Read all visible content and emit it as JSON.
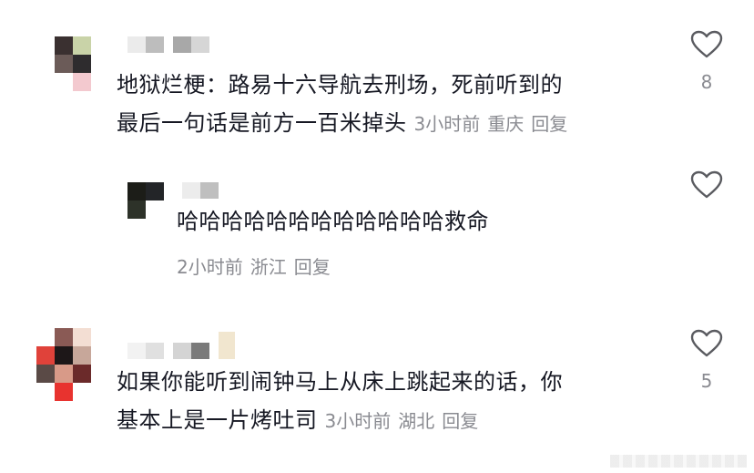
{
  "comments": [
    {
      "text_line1": "地狱烂梗：路易十六导航去刑场，死前听到的",
      "text_line2": "最后一句话是前方一百米掉头",
      "time": "3小时前",
      "location": "重庆",
      "reply_label": "回复",
      "likes": "8"
    },
    {
      "text_line1": "哈哈哈哈哈哈哈哈哈哈哈哈救命",
      "time": "2小时前",
      "location": "浙江",
      "reply_label": "回复"
    },
    {
      "text_line1": "如果你能听到闹钟马上从床上跳起来的话，你",
      "text_line2": "基本上是一片烤吐司",
      "time": "3小时前",
      "location": "湖北",
      "reply_label": "回复",
      "likes": "5"
    }
  ],
  "icons": {
    "like": "heart-outline-icon"
  },
  "colors": {
    "text": "#161823",
    "meta": "#8a8b91",
    "icon": "#5a5b60"
  }
}
